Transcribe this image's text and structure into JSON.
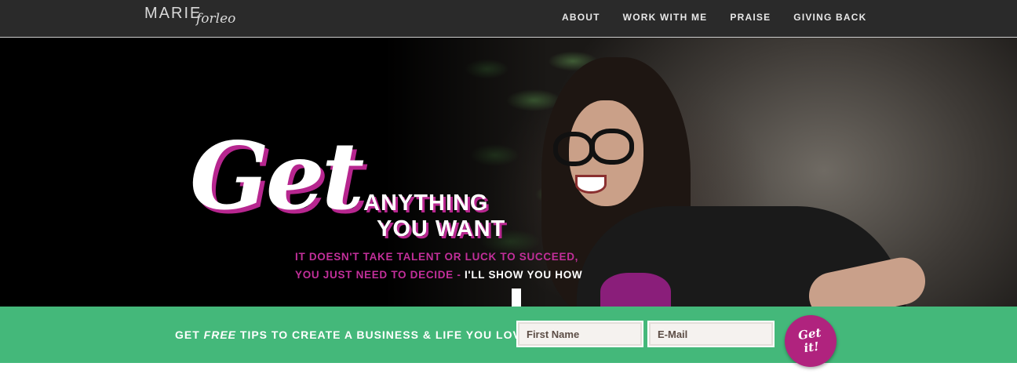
{
  "header": {
    "logo_main": "MARIE",
    "logo_script": "forleo",
    "nav": [
      {
        "label": "ABOUT"
      },
      {
        "label": "WORK WITH ME"
      },
      {
        "label": "PRAISE"
      },
      {
        "label": "GIVING BACK"
      }
    ]
  },
  "hero": {
    "script_word": "Get",
    "headline_line1": "ANYTHING",
    "headline_line2": "YOU WANT",
    "sub_line1": "IT DOESN'T TAKE TALENT OR LUCK TO SUCCEED,",
    "sub_line2_pink": "YOU JUST NEED TO DECIDE - ",
    "sub_line2_white": "I'LL SHOW YOU HOW",
    "arrow_icon": "down-arrow-icon"
  },
  "signup": {
    "text_before": "GET ",
    "text_emph": "FREE",
    "text_after": " TIPS TO CREATE A BUSINESS & LIFE YOU LOVE",
    "first_name_placeholder": "First Name",
    "email_placeholder": "E-Mail",
    "button_line1": "Get",
    "button_line2": "it!"
  },
  "colors": {
    "accent_pink": "#b7268f",
    "band_green": "#44b87a",
    "nav_bg": "#2a2a2a"
  }
}
